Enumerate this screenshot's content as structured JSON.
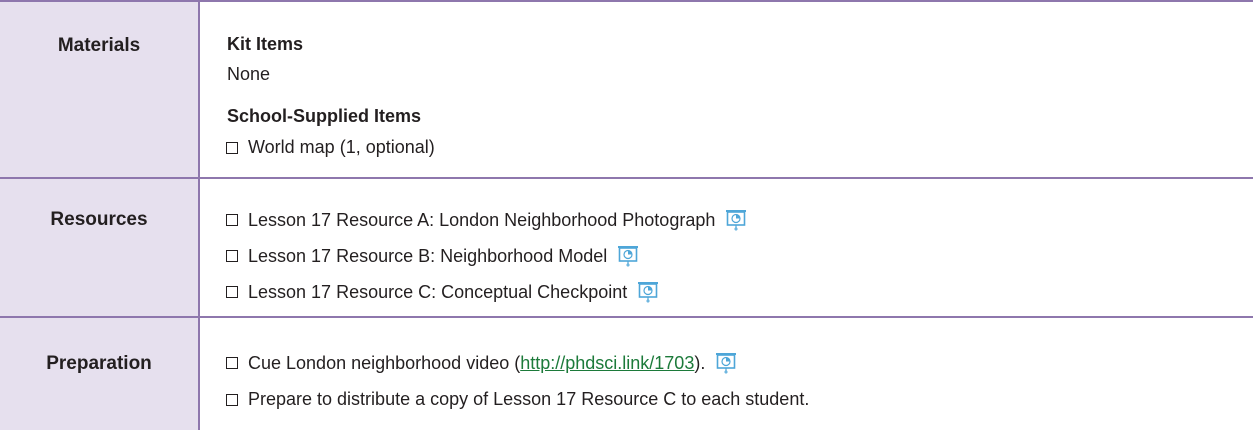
{
  "rows": {
    "materials": {
      "label": "Materials",
      "kit_heading": "Kit Items",
      "kit_value": "None",
      "school_heading": "School-Supplied Items",
      "school_items": [
        "World map (1, optional)"
      ]
    },
    "resources": {
      "label": "Resources",
      "items": [
        "Lesson 17 Resource A: London Neighborhood Photograph",
        "Lesson 17 Resource B: Neighborhood Model",
        "Lesson 17 Resource C: Conceptual Checkpoint"
      ]
    },
    "preparation": {
      "label": "Preparation",
      "item1_before": "Cue London neighborhood video (",
      "item1_link": "http://phdsci.link/1703",
      "item1_after": ").",
      "item2": "Prepare to distribute a copy of Lesson 17 Resource C to each student."
    }
  },
  "icons": {
    "projector": "projector-screen-icon"
  },
  "colors": {
    "border": "#8e77ad",
    "label_bg": "#e6e0ee",
    "icon": "#4ea6d8",
    "link": "#1c7a3a"
  }
}
